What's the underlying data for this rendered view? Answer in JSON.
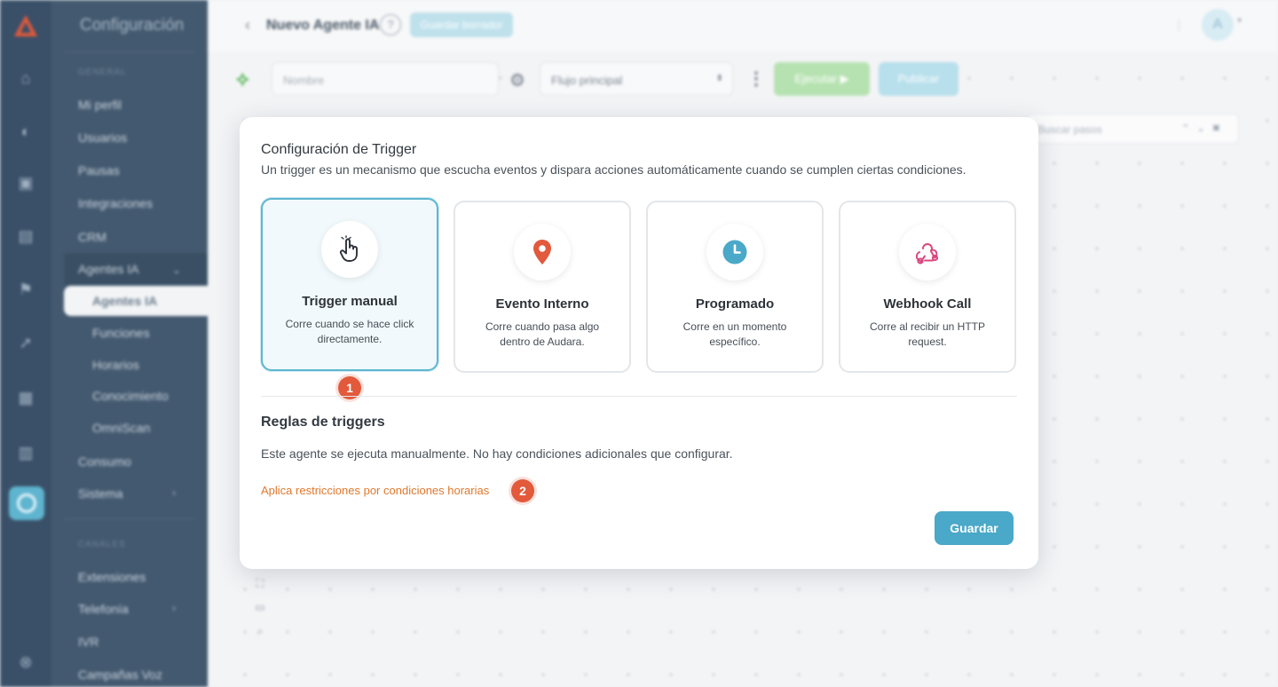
{
  "sidebar": {
    "title": "Configuración",
    "section_general": "GENERAL",
    "section_channels": "CANALES",
    "items": [
      {
        "label": "Mi perfil"
      },
      {
        "label": "Usuarios"
      },
      {
        "label": "Pausas"
      },
      {
        "label": "Integraciones"
      },
      {
        "label": "CRM"
      },
      {
        "label": "Agentes IA"
      },
      {
        "label": "Agentes IA"
      },
      {
        "label": "Funciones"
      },
      {
        "label": "Horarios"
      },
      {
        "label": "Conocimiento"
      },
      {
        "label": "OmniScan"
      },
      {
        "label": "Consumo"
      },
      {
        "label": "Sistema"
      },
      {
        "label": "Extensiones"
      },
      {
        "label": "Telefonía"
      },
      {
        "label": "IVR"
      },
      {
        "label": "Campañas Voz"
      }
    ]
  },
  "header": {
    "title": "Nuevo Agente IA",
    "help": "?",
    "draft_button": "Guardar borrador",
    "avatar_letter": "A"
  },
  "toolbar": {
    "name_placeholder": "Nombre",
    "flow_select": "Flujo principal",
    "run_button": "Ejecutar ▶",
    "publish_button": "Publicar",
    "search_placeholder": "Buscar pasos"
  },
  "modal": {
    "title": "Configuración de Trigger",
    "description": "Un trigger es un mecanismo que escucha eventos y dispara acciones automáticamente cuando se cumplen ciertas condiciones.",
    "cards": [
      {
        "title": "Trigger manual",
        "desc": "Corre cuando se hace click directamente.",
        "icon": "hand-pointer-icon",
        "selected": true
      },
      {
        "title": "Evento Interno",
        "desc": "Corre cuando pasa algo dentro de Audara.",
        "icon": "map-pin-icon",
        "selected": false
      },
      {
        "title": "Programado",
        "desc": "Corre en un momento específico.",
        "icon": "clock-icon",
        "selected": false
      },
      {
        "title": "Webhook Call",
        "desc": "Corre al recibir un HTTP request.",
        "icon": "webhook-icon",
        "selected": false
      }
    ],
    "rules_title": "Reglas de triggers",
    "rules_text": "Este agente se ejecuta manualmente. No hay condiciones adicionales que configurar.",
    "time_restrictions_link": "Aplica restricciones por condiciones horarias",
    "save_button": "Guardar",
    "badge_1": "1",
    "badge_2": "2"
  },
  "colors": {
    "accent": "#4aa8c8",
    "badge": "#e2593b",
    "link": "#e0782e",
    "sidebar": "#43596f"
  }
}
